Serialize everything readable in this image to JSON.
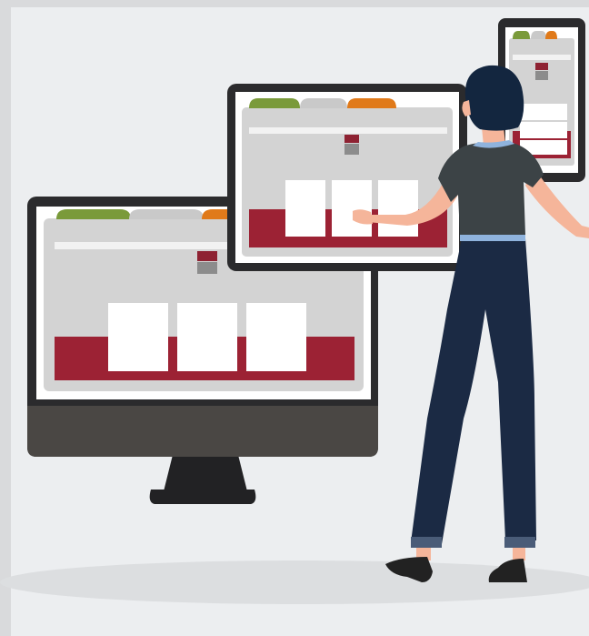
{
  "illustration": {
    "subject": "person-arranging-responsive-layouts",
    "devices": [
      "desktop-monitor",
      "tablet",
      "phone"
    ],
    "colors": {
      "background": "#eceef0",
      "frame": "#d9dadc",
      "floor": "#dcdee0",
      "device_bezel": "#2b2b2d",
      "monitor_chin": "#4a4744",
      "monitor_stand": "#222224",
      "screen_bg": "#ffffff",
      "browser_body": "#d3d3d3",
      "header_bar": "#f2f2f2",
      "tab_green": "#7a9a3a",
      "tab_gray": "#c9c9c9",
      "tab_orange": "#e07a1a",
      "hero_red": "#9c2234",
      "logo_red": "#8e2232",
      "logo_gray": "#8c8c8c",
      "card_white": "#ffffff",
      "person_hair": "#13263f",
      "person_skin": "#f5b59a",
      "person_shirt": "#3c4346",
      "person_pants": "#1b2a44",
      "person_belt": "#8fb3dd",
      "person_cuff": "#4a5c78",
      "person_shoe": "#222222"
    }
  }
}
